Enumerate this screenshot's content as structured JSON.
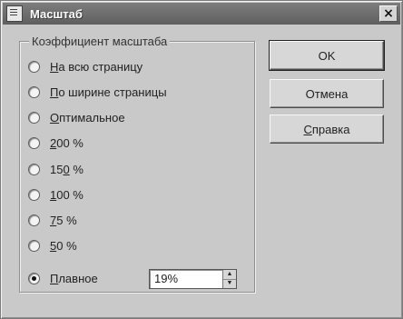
{
  "window": {
    "title": "Масштаб",
    "close_glyph": "×"
  },
  "group": {
    "label": "Коэффициент масштаба",
    "options": [
      {
        "prefix": "",
        "mnemonic": "Н",
        "rest": "а всю страницу",
        "checked": false
      },
      {
        "prefix": "",
        "mnemonic": "П",
        "rest": "о ширине страницы",
        "checked": false
      },
      {
        "prefix": "",
        "mnemonic": "О",
        "rest": "птимальное",
        "checked": false
      },
      {
        "prefix": "",
        "mnemonic": "2",
        "rest": "00 %",
        "checked": false
      },
      {
        "prefix": "15",
        "mnemonic": "0",
        "rest": " %",
        "checked": false
      },
      {
        "prefix": "",
        "mnemonic": "1",
        "rest": "00 %",
        "checked": false
      },
      {
        "prefix": "",
        "mnemonic": "7",
        "rest": "5 %",
        "checked": false
      },
      {
        "prefix": "",
        "mnemonic": "5",
        "rest": "0 %",
        "checked": false
      },
      {
        "prefix": "",
        "mnemonic": "П",
        "rest": "лавное",
        "checked": true
      }
    ]
  },
  "smooth": {
    "value": "19%"
  },
  "buttons": {
    "ok": "OK",
    "cancel": "Отмена",
    "help_mnemonic": "С",
    "help_rest": "правка"
  }
}
